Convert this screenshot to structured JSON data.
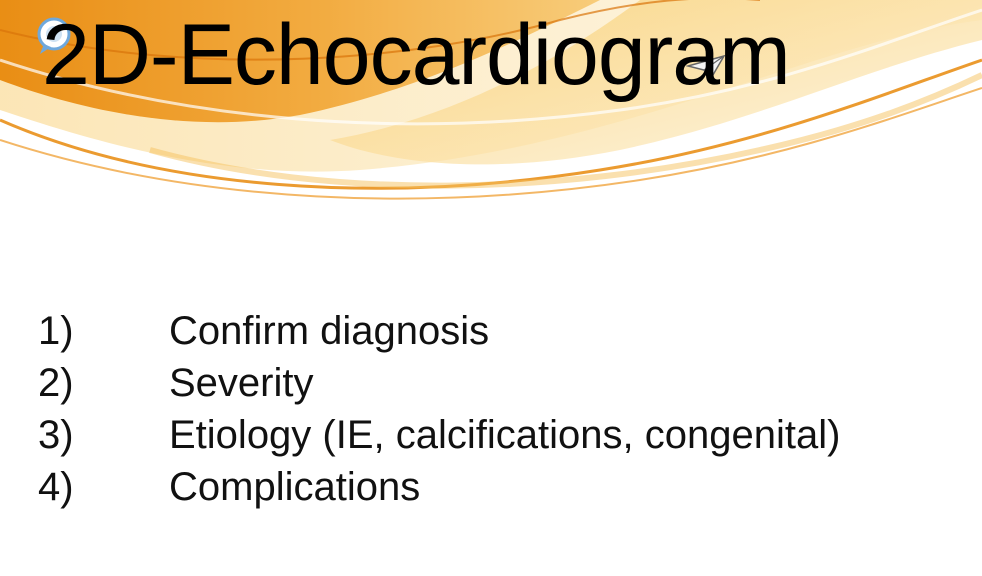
{
  "slide": {
    "title": "2D-Echocardiogram",
    "items": [
      {
        "number": "1)",
        "text": "Confirm diagnosis"
      },
      {
        "number": "2)",
        "text": "Severity"
      },
      {
        "number": "3)",
        "text": "Etiology (IE, calcifications, congenital)"
      },
      {
        "number": "4)",
        "text": "Complications"
      }
    ]
  },
  "theme": {
    "swoosh_colors": [
      "#E8890C",
      "#F2A93B",
      "#F7C870",
      "#FBE3AE"
    ],
    "logo_icon": "speech-bubble-logo",
    "corner_icon": "paper-plane-icon"
  }
}
